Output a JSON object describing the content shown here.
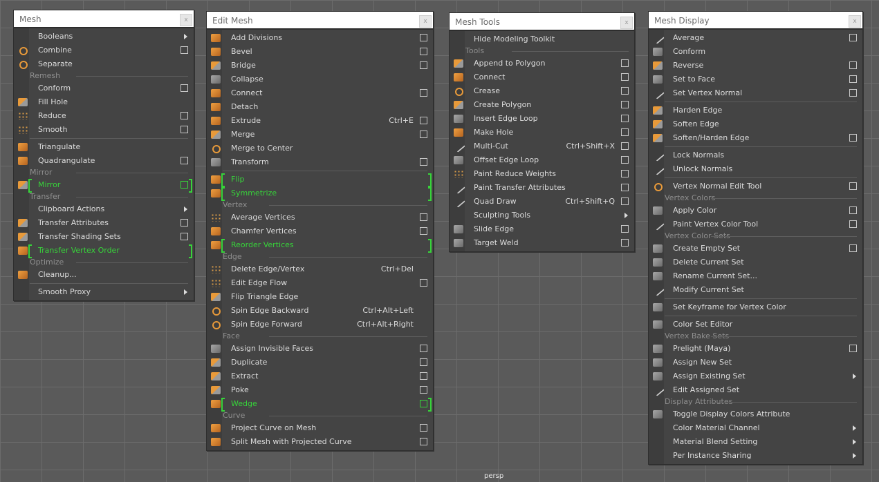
{
  "viewport": {
    "label": "persp"
  },
  "panels": {
    "mesh": {
      "title": "Mesh",
      "close": "x",
      "items": [
        {
          "kind": "item",
          "label": "Booleans",
          "arrow": true
        },
        {
          "kind": "item",
          "label": "Combine",
          "checkbox": true,
          "icon": "combine-icon",
          "style": "ring"
        },
        {
          "kind": "item",
          "label": "Separate",
          "icon": "separate-icon",
          "style": "ring"
        },
        {
          "kind": "section",
          "label": "Remesh"
        },
        {
          "kind": "item",
          "label": "Conform",
          "checkbox": true
        },
        {
          "kind": "item",
          "label": "Fill Hole",
          "icon": "fill-hole-icon",
          "style": "mix"
        },
        {
          "kind": "item",
          "label": "Reduce",
          "checkbox": true,
          "icon": "reduce-icon",
          "style": "dots"
        },
        {
          "kind": "item",
          "label": "Smooth",
          "checkbox": true,
          "icon": "smooth-icon",
          "style": "dots"
        },
        {
          "kind": "divider"
        },
        {
          "kind": "item",
          "label": "Triangulate",
          "icon": "triangulate-icon",
          "style": "orange"
        },
        {
          "kind": "item",
          "label": "Quadrangulate",
          "checkbox": true,
          "icon": "quadrangulate-icon",
          "style": "orange"
        },
        {
          "kind": "section",
          "label": "Mirror"
        },
        {
          "kind": "item",
          "label": "Mirror",
          "checkbox": true,
          "highlight": true,
          "icon": "mirror-icon",
          "style": "mix"
        },
        {
          "kind": "section",
          "label": "Transfer"
        },
        {
          "kind": "item",
          "label": "Clipboard Actions",
          "arrow": true
        },
        {
          "kind": "item",
          "label": "Transfer Attributes",
          "checkbox": true,
          "icon": "transfer-attributes-icon",
          "style": "mix"
        },
        {
          "kind": "item",
          "label": "Transfer Shading Sets",
          "checkbox": true,
          "icon": "transfer-shading-icon",
          "style": "mix"
        },
        {
          "kind": "item",
          "label": "Transfer Vertex Order",
          "highlight": true,
          "icon": "transfer-vertex-order-icon",
          "style": "orange"
        },
        {
          "kind": "section",
          "label": "Optimize"
        },
        {
          "kind": "item",
          "label": "Cleanup...",
          "icon": "cleanup-icon",
          "style": "orange"
        },
        {
          "kind": "divider"
        },
        {
          "kind": "item",
          "label": "Smooth Proxy",
          "arrow": true
        }
      ]
    },
    "edit_mesh": {
      "title": "Edit Mesh",
      "close": "x",
      "items": [
        {
          "kind": "item",
          "label": "Add Divisions",
          "checkbox": true,
          "icon": "add-divisions-icon",
          "style": "orange"
        },
        {
          "kind": "item",
          "label": "Bevel",
          "checkbox": true,
          "icon": "bevel-icon",
          "style": "orange"
        },
        {
          "kind": "item",
          "label": "Bridge",
          "checkbox": true,
          "icon": "bridge-icon",
          "style": "mix"
        },
        {
          "kind": "item",
          "label": "Collapse",
          "icon": "collapse-icon",
          "style": "grey"
        },
        {
          "kind": "item",
          "label": "Connect",
          "checkbox": true,
          "icon": "connect-icon",
          "style": "orange"
        },
        {
          "kind": "item",
          "label": "Detach",
          "icon": "detach-icon",
          "style": "orange"
        },
        {
          "kind": "item",
          "label": "Extrude",
          "shortcut": "Ctrl+E",
          "checkbox": true,
          "icon": "extrude-icon",
          "style": "orange"
        },
        {
          "kind": "item",
          "label": "Merge",
          "checkbox": true,
          "icon": "merge-icon",
          "style": "mix"
        },
        {
          "kind": "item",
          "label": "Merge to Center",
          "icon": "merge-to-center-icon",
          "style": "ring"
        },
        {
          "kind": "item",
          "label": "Transform",
          "checkbox": true,
          "icon": "transform-icon",
          "style": "grey"
        },
        {
          "kind": "divider"
        },
        {
          "kind": "item",
          "label": "Flip",
          "highlight": true,
          "icon": "flip-icon",
          "style": "orange"
        },
        {
          "kind": "item",
          "label": "Symmetrize",
          "highlight": true,
          "icon": "symmetrize-icon",
          "style": "orange"
        },
        {
          "kind": "section",
          "label": "Vertex"
        },
        {
          "kind": "item",
          "label": "Average Vertices",
          "checkbox": true,
          "icon": "average-vertices-icon",
          "style": "dots"
        },
        {
          "kind": "item",
          "label": "Chamfer Vertices",
          "checkbox": true,
          "icon": "chamfer-vertices-icon",
          "style": "orange"
        },
        {
          "kind": "item",
          "label": "Reorder Vertices",
          "highlight": true,
          "icon": "reorder-vertices-icon",
          "style": "orange"
        },
        {
          "kind": "section",
          "label": "Edge"
        },
        {
          "kind": "item",
          "label": "Delete Edge/Vertex",
          "shortcut": "Ctrl+Del",
          "icon": "delete-edge-icon",
          "style": "dots"
        },
        {
          "kind": "item",
          "label": "Edit Edge Flow",
          "checkbox": true,
          "icon": "edit-edge-flow-icon",
          "style": "dots"
        },
        {
          "kind": "item",
          "label": "Flip Triangle Edge",
          "icon": "flip-triangle-edge-icon",
          "style": "mix"
        },
        {
          "kind": "item",
          "label": "Spin Edge Backward",
          "shortcut": "Ctrl+Alt+Left",
          "icon": "spin-edge-backward-icon",
          "style": "ring"
        },
        {
          "kind": "item",
          "label": "Spin Edge Forward",
          "shortcut": "Ctrl+Alt+Right",
          "icon": "spin-edge-forward-icon",
          "style": "ring"
        },
        {
          "kind": "section",
          "label": "Face"
        },
        {
          "kind": "item",
          "label": "Assign Invisible Faces",
          "checkbox": true,
          "icon": "invisible-faces-icon",
          "style": "grey"
        },
        {
          "kind": "item",
          "label": "Duplicate",
          "checkbox": true,
          "icon": "duplicate-icon",
          "style": "mix"
        },
        {
          "kind": "item",
          "label": "Extract",
          "checkbox": true,
          "icon": "extract-icon",
          "style": "mix"
        },
        {
          "kind": "item",
          "label": "Poke",
          "checkbox": true,
          "icon": "poke-icon",
          "style": "mix"
        },
        {
          "kind": "item",
          "label": "Wedge",
          "checkbox": true,
          "highlight": true,
          "icon": "wedge-icon",
          "style": "orange"
        },
        {
          "kind": "section",
          "label": "Curve"
        },
        {
          "kind": "item",
          "label": "Project Curve on Mesh",
          "checkbox": true,
          "icon": "project-curve-icon",
          "style": "orange"
        },
        {
          "kind": "item",
          "label": "Split Mesh with Projected Curve",
          "checkbox": true,
          "icon": "split-mesh-icon",
          "style": "orange"
        }
      ]
    },
    "mesh_tools": {
      "title": "Mesh Tools",
      "close": "x",
      "items": [
        {
          "kind": "item",
          "label": "Hide Modeling Toolkit"
        },
        {
          "kind": "section",
          "label": "Tools"
        },
        {
          "kind": "item",
          "label": "Append to Polygon",
          "checkbox": true,
          "icon": "append-polygon-icon",
          "style": "mix"
        },
        {
          "kind": "item",
          "label": "Connect",
          "checkbox": true,
          "icon": "connect-tool-icon",
          "style": "orange"
        },
        {
          "kind": "item",
          "label": "Crease",
          "checkbox": true,
          "icon": "crease-icon",
          "style": "ring"
        },
        {
          "kind": "item",
          "label": "Create Polygon",
          "checkbox": true,
          "icon": "create-polygon-icon",
          "style": "mix"
        },
        {
          "kind": "item",
          "label": "Insert Edge Loop",
          "checkbox": true,
          "icon": "insert-edge-loop-icon",
          "style": "grey"
        },
        {
          "kind": "item",
          "label": "Make Hole",
          "checkbox": true,
          "icon": "make-hole-icon",
          "style": "orange"
        },
        {
          "kind": "item",
          "label": "Multi-Cut",
          "shortcut": "Ctrl+Shift+X",
          "checkbox": true,
          "icon": "multi-cut-icon",
          "style": "line"
        },
        {
          "kind": "item",
          "label": "Offset Edge Loop",
          "checkbox": true,
          "icon": "offset-edge-loop-icon",
          "style": "grey"
        },
        {
          "kind": "item",
          "label": "Paint Reduce Weights",
          "checkbox": true,
          "icon": "paint-reduce-icon",
          "style": "dots"
        },
        {
          "kind": "item",
          "label": "Paint Transfer Attributes",
          "checkbox": true,
          "icon": "paint-transfer-icon",
          "style": "line"
        },
        {
          "kind": "item",
          "label": "Quad Draw",
          "shortcut": "Ctrl+Shift+Q",
          "checkbox": true,
          "icon": "quad-draw-icon",
          "style": "line"
        },
        {
          "kind": "item",
          "label": "Sculpting Tools",
          "arrow": true
        },
        {
          "kind": "item",
          "label": "Slide Edge",
          "checkbox": true,
          "icon": "slide-edge-icon",
          "style": "grey"
        },
        {
          "kind": "item",
          "label": "Target Weld",
          "checkbox": true,
          "icon": "target-weld-icon",
          "style": "grey"
        }
      ]
    },
    "mesh_display": {
      "title": "Mesh Display",
      "close": "x",
      "items": [
        {
          "kind": "item",
          "label": "Average",
          "checkbox": true,
          "icon": "average-normals-icon",
          "style": "line"
        },
        {
          "kind": "item",
          "label": "Conform",
          "icon": "conform-normals-icon",
          "style": "grey"
        },
        {
          "kind": "item",
          "label": "Reverse",
          "checkbox": true,
          "icon": "reverse-normals-icon",
          "style": "mix"
        },
        {
          "kind": "item",
          "label": "Set to Face",
          "checkbox": true,
          "icon": "set-to-face-icon",
          "style": "grey"
        },
        {
          "kind": "item",
          "label": "Set Vertex Normal",
          "checkbox": true,
          "icon": "set-vertex-normal-icon",
          "style": "line"
        },
        {
          "kind": "divider"
        },
        {
          "kind": "item",
          "label": "Harden Edge",
          "icon": "harden-edge-icon",
          "style": "mix"
        },
        {
          "kind": "item",
          "label": "Soften Edge",
          "icon": "soften-edge-icon",
          "style": "mix"
        },
        {
          "kind": "item",
          "label": "Soften/Harden Edge",
          "checkbox": true,
          "icon": "soften-harden-icon",
          "style": "mix"
        },
        {
          "kind": "divider"
        },
        {
          "kind": "item",
          "label": "Lock Normals",
          "icon": "lock-normals-icon",
          "style": "line"
        },
        {
          "kind": "item",
          "label": "Unlock Normals",
          "icon": "unlock-normals-icon",
          "style": "line"
        },
        {
          "kind": "divider"
        },
        {
          "kind": "item",
          "label": "Vertex Normal Edit Tool",
          "checkbox": true,
          "icon": "vertex-normal-edit-icon",
          "style": "ring"
        },
        {
          "kind": "section",
          "label": "Vertex Colors"
        },
        {
          "kind": "item",
          "label": "Apply Color",
          "checkbox": true,
          "icon": "apply-color-icon",
          "style": "grey"
        },
        {
          "kind": "item",
          "label": "Paint Vertex Color Tool",
          "checkbox": true,
          "icon": "paint-vertex-color-icon",
          "style": "line"
        },
        {
          "kind": "section",
          "label": "Vertex Color Sets"
        },
        {
          "kind": "item",
          "label": "Create Empty Set",
          "checkbox": true,
          "icon": "create-empty-set-icon",
          "style": "grey"
        },
        {
          "kind": "item",
          "label": "Delete Current Set",
          "icon": "delete-current-set-icon",
          "style": "grey"
        },
        {
          "kind": "item",
          "label": "Rename Current Set...",
          "icon": "rename-current-set-icon",
          "style": "grey"
        },
        {
          "kind": "item",
          "label": "Modify Current Set",
          "icon": "modify-current-set-icon",
          "style": "line"
        },
        {
          "kind": "divider"
        },
        {
          "kind": "item",
          "label": "Set Keyframe for Vertex Color",
          "icon": "keyframe-vertex-color-icon",
          "style": "grey"
        },
        {
          "kind": "divider"
        },
        {
          "kind": "item",
          "label": "Color Set Editor",
          "icon": "color-set-editor-icon",
          "style": "grey"
        },
        {
          "kind": "section",
          "label": "Vertex Bake Sets"
        },
        {
          "kind": "item",
          "label": "Prelight (Maya)",
          "checkbox": true,
          "icon": "prelight-icon",
          "style": "grey"
        },
        {
          "kind": "item",
          "label": "Assign New Set",
          "icon": "assign-new-set-icon",
          "style": "grey"
        },
        {
          "kind": "item",
          "label": "Assign Existing Set",
          "arrow": true,
          "icon": "assign-existing-set-icon",
          "style": "grey"
        },
        {
          "kind": "item",
          "label": "Edit Assigned Set",
          "icon": "edit-assigned-set-icon",
          "style": "line"
        },
        {
          "kind": "section",
          "label": "Display Attributes"
        },
        {
          "kind": "item",
          "label": "Toggle Display Colors Attribute",
          "icon": "toggle-display-colors-icon",
          "style": "grey"
        },
        {
          "kind": "item",
          "label": "Color Material Channel",
          "arrow": true
        },
        {
          "kind": "item",
          "label": "Material Blend Setting",
          "arrow": true
        },
        {
          "kind": "item",
          "label": "Per Instance Sharing",
          "arrow": true
        }
      ]
    }
  },
  "colors": {
    "highlight": "#37d43a",
    "panel_bg": "#444444",
    "title_bg": "#ffffff"
  }
}
